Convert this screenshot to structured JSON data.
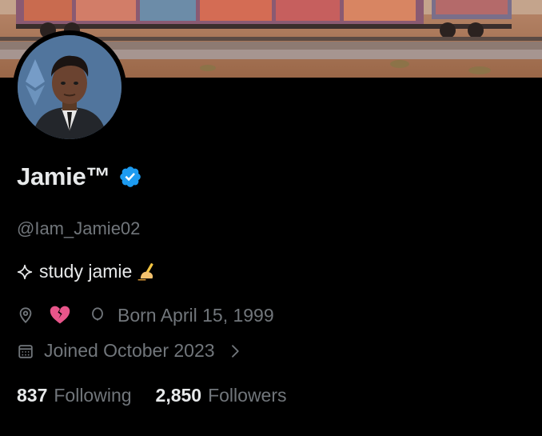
{
  "profile": {
    "display_name": "Jamie™",
    "handle": "@Iam_Jamie02",
    "bio_text": "study jamie",
    "birth": "Born April 15, 1999",
    "joined": "Joined October 2023"
  },
  "stats": {
    "following_count": "837",
    "following_label": "Following",
    "followers_count": "2,850",
    "followers_label": "Followers"
  },
  "icons": {
    "verified": "verified-badge-icon",
    "bio_left": "sparkle-icon",
    "bio_right": "writing-hand-emoji-icon",
    "location": "location-pin-icon",
    "location_value": "broken-heart-emoji-icon",
    "birthday": "balloon-icon",
    "calendar": "calendar-icon",
    "chevron": "chevron-right-icon"
  },
  "colors": {
    "background": "#000000",
    "primary_text": "#e7e9ea",
    "secondary_text": "#71767b",
    "verified_blue": "#1d9bf0",
    "heart_pink": "#e8558a"
  }
}
